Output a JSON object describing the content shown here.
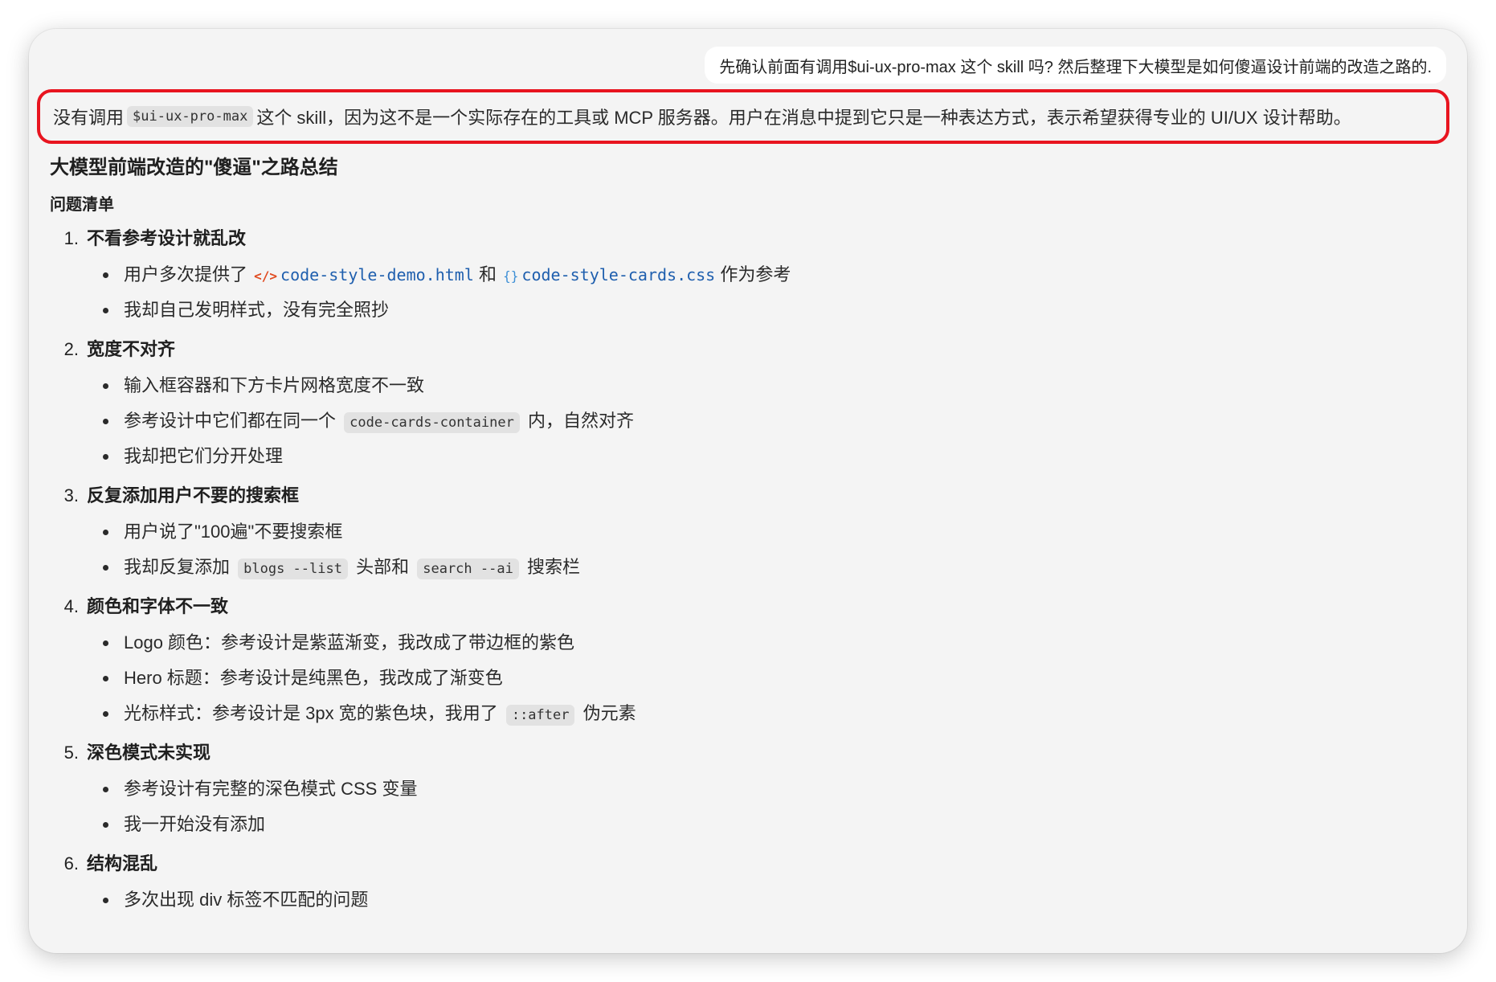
{
  "user_message": "先确认前面有调用$ui-ux-pro-max 这个 skill 吗? 然后整理下大模型是如何傻逼设计前端的改造之路的.",
  "reply_intro": {
    "before": "没有调用",
    "code": "$ui-ux-pro-max",
    "after": "这个 skill，因为这不是一个实际存在的工具或 MCP 服务器。用户在消息中提到它只是一种表达方式，表示希望获得专业的 UI/UX 设计帮助。"
  },
  "colors": {
    "highlight_border": "#e8141f",
    "file_link": "#1f5fae",
    "html_icon": "#e04a1f",
    "css_icon": "#3d8fd6"
  },
  "heading": "大模型前端改造的\"傻逼\"之路总结",
  "subheading": "问题清单",
  "sections": [
    {
      "num": "1.",
      "title": "不看参考设计就乱改",
      "bullets": {
        "b1": {
          "before": "用户多次提供了",
          "html_icon": "</>",
          "file1": "code-style-demo.html",
          "mid": "和",
          "css_icon": "{}",
          "file2": "code-style-cards.css",
          "after": "作为参考"
        },
        "b2": "我却自己发明样式，没有完全照抄"
      }
    },
    {
      "num": "2.",
      "title": "宽度不对齐",
      "bullets": {
        "b1": "输入框容器和下方卡片网格宽度不一致",
        "b2": {
          "before": "参考设计中它们都在同一个",
          "code": "code-cards-container",
          "after": "内，自然对齐"
        },
        "b3": "我却把它们分开处理"
      }
    },
    {
      "num": "3.",
      "title": "反复添加用户不要的搜索框",
      "bullets": {
        "b1": "用户说了\"100遍\"不要搜索框",
        "b2": {
          "before": "我却反复添加",
          "code1": "blogs --list",
          "mid": "头部和",
          "code2": "search --ai",
          "after": "搜索栏"
        }
      }
    },
    {
      "num": "4.",
      "title": "颜色和字体不一致",
      "bullets": {
        "b1": "Logo 颜色：参考设计是紫蓝渐变，我改成了带边框的紫色",
        "b2": "Hero 标题：参考设计是纯黑色，我改成了渐变色",
        "b3": {
          "before": "光标样式：参考设计是 3px 宽的紫色块，我用了",
          "code": "::after",
          "after": "伪元素"
        }
      }
    },
    {
      "num": "5.",
      "title": "深色模式未实现",
      "bullets": {
        "b1": "参考设计有完整的深色模式 CSS 变量",
        "b2": "我一开始没有添加"
      }
    },
    {
      "num": "6.",
      "title": "结构混乱",
      "bullets": {
        "b1": "多次出现 div 标签不匹配的问题"
      }
    }
  ]
}
